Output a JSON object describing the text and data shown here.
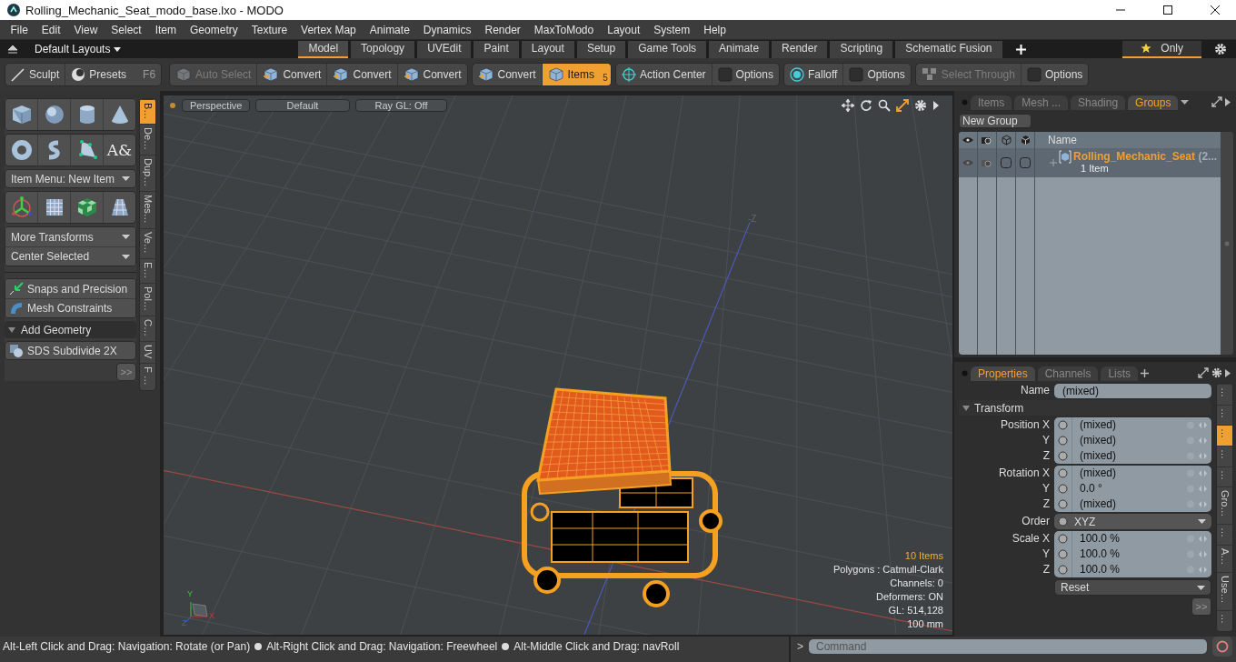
{
  "window": {
    "title": "Rolling_Mechanic_Seat_modo_base.lxo - MODO"
  },
  "menu": [
    "File",
    "Edit",
    "View",
    "Select",
    "Item",
    "Geometry",
    "Texture",
    "Vertex Map",
    "Animate",
    "Dynamics",
    "Render",
    "MaxToModo",
    "Layout",
    "System",
    "Help"
  ],
  "layout_bar": {
    "layouts_label": "Default Layouts",
    "tabs": [
      {
        "label": "Model",
        "selected": true
      },
      {
        "label": "Topology",
        "selected": false
      },
      {
        "label": "UVEdit",
        "selected": false
      },
      {
        "label": "Paint",
        "selected": false
      },
      {
        "label": "Layout",
        "selected": false
      },
      {
        "label": "Setup",
        "selected": false
      },
      {
        "label": "Game Tools",
        "selected": false
      },
      {
        "label": "Animate",
        "selected": false
      },
      {
        "label": "Render",
        "selected": false
      },
      {
        "label": "Scripting",
        "selected": false
      },
      {
        "label": "Schematic Fusion",
        "selected": false
      }
    ],
    "only_label": "Only",
    "only_selected": true
  },
  "toolbar": {
    "mode_buttons": [
      {
        "label": "Sculpt",
        "kind": "brush"
      },
      {
        "label": "Presets",
        "kind": "ball",
        "shortcut": "F6"
      }
    ],
    "groups": [
      [
        {
          "label": "Auto Select",
          "kind": "cube",
          "disabled": true,
          "selected": false
        },
        {
          "label": "Convert",
          "kind": "convert",
          "disabled": false,
          "selected": false
        },
        {
          "label": "Convert",
          "kind": "convert",
          "disabled": false,
          "selected": false
        },
        {
          "label": "Convert",
          "kind": "convert",
          "disabled": false,
          "selected": false
        }
      ],
      [
        {
          "label": "Convert",
          "kind": "convert",
          "disabled": false,
          "selected": false
        },
        {
          "label": "Items",
          "kind": "cube",
          "disabled": false,
          "selected": true,
          "count": "5"
        }
      ],
      [
        {
          "label": "Action Center",
          "kind": "crosshair",
          "disabled": false,
          "selected": false
        },
        {
          "label": "Options",
          "kind": "square",
          "disabled": false,
          "selected": false
        }
      ],
      [
        {
          "label": "Falloff",
          "kind": "rings",
          "disabled": false,
          "selected": false
        },
        {
          "label": "Options",
          "kind": "square",
          "disabled": false,
          "selected": false
        }
      ],
      [
        {
          "label": "Select Through",
          "kind": "boxes",
          "disabled": true,
          "selected": false
        },
        {
          "label": "Options",
          "kind": "square",
          "disabled": false,
          "selected": false
        }
      ]
    ]
  },
  "left_panel": {
    "text_tool_glyph": "A&",
    "item_menu": "Item Menu: New Item",
    "transform_menus": [
      "More Transforms",
      "Center Selected"
    ],
    "tool_buttons": [
      {
        "label": "Snaps and Precision",
        "kind": "snap"
      },
      {
        "label": "Mesh Constraints",
        "kind": "constraint"
      }
    ],
    "section": {
      "label": "Add Geometry",
      "expanded": true
    },
    "section_buttons": [
      "SDS Subdivide 2X"
    ],
    "more_label": ">>",
    "side_tabs": [
      {
        "label": "B…",
        "selected": true
      },
      {
        "label": "De…",
        "selected": false
      },
      {
        "label": "Dup…",
        "selected": false
      },
      {
        "label": "Mes…",
        "selected": false
      },
      {
        "label": "Ve…",
        "selected": false
      },
      {
        "label": "E…",
        "selected": false
      },
      {
        "label": "Pol…",
        "selected": false
      },
      {
        "label": "C…",
        "selected": false
      },
      {
        "label": "UV",
        "selected": false
      },
      {
        "label": "F …",
        "selected": false
      }
    ]
  },
  "viewport": {
    "view_buttons": [
      "Perspective",
      "Default",
      "Ray GL: Off"
    ],
    "direction_label": "-Z",
    "stats": [
      {
        "text": "10 Items",
        "highlight": true
      },
      {
        "text": "Polygons : Catmull-Clark",
        "highlight": false
      },
      {
        "text": "Channels: 0",
        "highlight": false
      },
      {
        "text": "Deformers: ON",
        "highlight": false
      },
      {
        "text": "GL: 514,128",
        "highlight": false
      },
      {
        "text": "100 mm",
        "highlight": false
      }
    ],
    "axis_labels": {
      "y": "Y",
      "x": "X",
      "z": "Z"
    }
  },
  "status_bar": {
    "hints": [
      "Alt-Left Click and Drag: Navigation: Rotate (or Pan)",
      "Alt-Right Click and Drag: Navigation: Freewheel",
      "Alt-Middle Click and Drag: navRoll"
    ]
  },
  "groups_panel": {
    "tabs": [
      {
        "label": "Items",
        "selected": false
      },
      {
        "label": "Mesh ...",
        "selected": false
      },
      {
        "label": "Shading",
        "selected": false
      },
      {
        "label": "Groups",
        "selected": true
      }
    ],
    "new_group_label": "New Group",
    "name_column": "Name",
    "rows": [
      {
        "name": "Rolling_Mechanic_Seat",
        "suffix": "(2...",
        "subtitle": "1 Item",
        "selected": true
      }
    ]
  },
  "properties_panel": {
    "tabs": [
      {
        "label": "Properties",
        "selected": true
      },
      {
        "label": "Channels",
        "selected": false
      },
      {
        "label": "Lists",
        "selected": false
      }
    ],
    "name_label": "Name",
    "name_value": "(mixed)",
    "section": {
      "label": "Transform",
      "expanded": true
    },
    "groups": [
      {
        "kind": "vector",
        "rows": [
          {
            "label": "Position X",
            "value": "(mixed)"
          },
          {
            "label": "Y",
            "value": "(mixed)"
          },
          {
            "label": "Z",
            "value": "(mixed)"
          }
        ]
      },
      {
        "kind": "vector",
        "rows": [
          {
            "label": "Rotation X",
            "value": "(mixed)"
          },
          {
            "label": "Y",
            "value": "0.0 °"
          },
          {
            "label": "Z",
            "value": "(mixed)"
          }
        ]
      },
      {
        "kind": "choice",
        "rows": [
          {
            "label": "Order",
            "value": "XYZ"
          }
        ]
      },
      {
        "kind": "vector",
        "rows": [
          {
            "label": "Scale X",
            "value": "100.0 %"
          },
          {
            "label": "Y",
            "value": "100.0 %"
          },
          {
            "label": "Z",
            "value": "100.0 %"
          }
        ]
      }
    ],
    "reset_label": "Reset",
    "more_label": ">>",
    "side_tabs": [
      {
        "label": "…",
        "selected": false
      },
      {
        "label": "…",
        "selected": false
      },
      {
        "label": "…",
        "selected": true
      },
      {
        "label": "…",
        "selected": false
      },
      {
        "label": "…",
        "selected": false
      },
      {
        "label": "Gro…",
        "selected": false
      },
      {
        "label": "…",
        "selected": false
      },
      {
        "label": "A…",
        "selected": false
      },
      {
        "label": "Use…",
        "selected": false
      },
      {
        "label": "…",
        "selected": false
      }
    ]
  },
  "command": {
    "prompt": ">",
    "placeholder": "Command"
  }
}
